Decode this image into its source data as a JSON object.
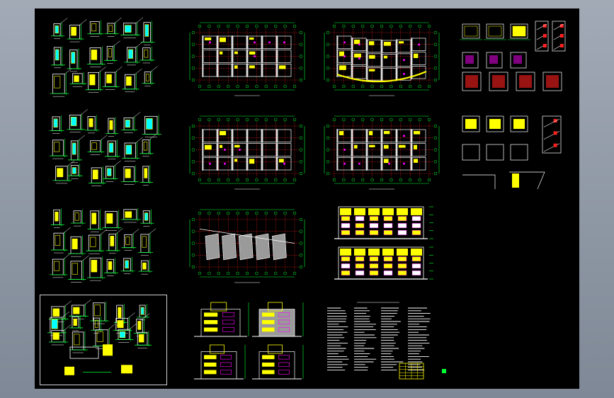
{
  "viewer": {
    "colors": {
      "outer_background": "#8e97a4",
      "viewport_background": "#000000",
      "sheet_border": "#cfd3d8",
      "cad_white": "#ffffff",
      "cad_yellow": "#ffff00",
      "cad_red": "#ff2020",
      "cad_green": "#00ff33",
      "cad_cyan": "#00ffff",
      "cad_magenta": "#ff00ff",
      "cad_gray": "#9a9a9a"
    }
  },
  "sheets": [
    {
      "kind": "detail-sheet",
      "title": ""
    },
    {
      "kind": "floor-plan",
      "title": ""
    },
    {
      "kind": "floor-plan-curved",
      "title": ""
    },
    {
      "kind": "section-details",
      "title": ""
    },
    {
      "kind": "detail-sheet",
      "title": ""
    },
    {
      "kind": "floor-plan",
      "title": ""
    },
    {
      "kind": "floor-plan",
      "title": ""
    },
    {
      "kind": "stair-details",
      "title": ""
    },
    {
      "kind": "detail-sheet",
      "title": ""
    },
    {
      "kind": "roof-plan",
      "title": ""
    },
    {
      "kind": "elevations",
      "title": ""
    },
    {
      "kind": "detail-sheet-selected",
      "title": ""
    },
    {
      "kind": "side-elevations",
      "title": ""
    },
    {
      "kind": "general-notes",
      "title": ""
    }
  ]
}
